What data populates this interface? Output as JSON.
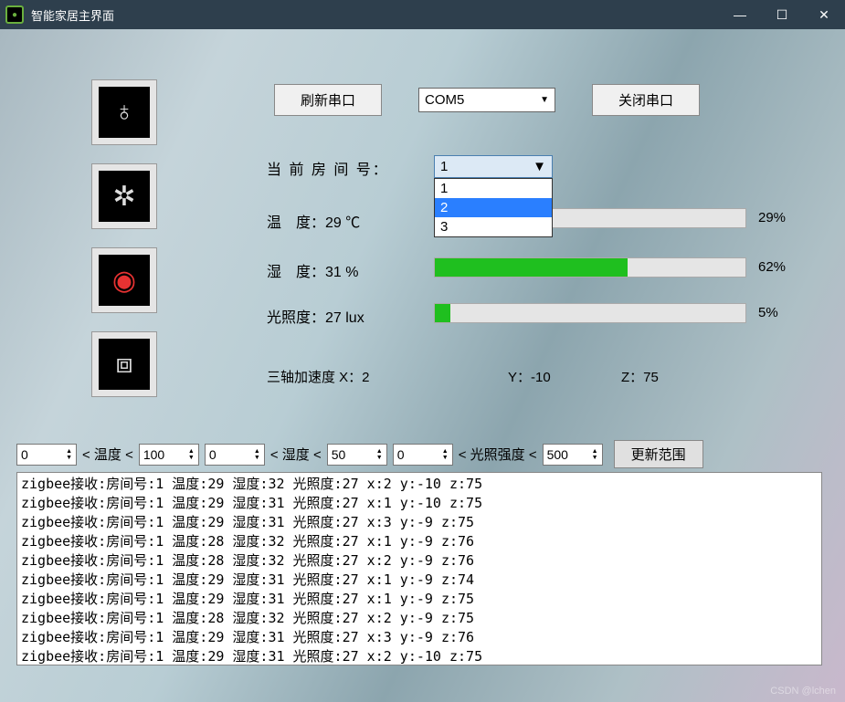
{
  "window": {
    "title": "智能家居主界面",
    "min": "—",
    "max": "☐",
    "close": "✕"
  },
  "icons": {
    "bulb": "bulb-icon",
    "fan": "fan-icon",
    "alarm": "alarm-icon",
    "segment": "seven-segment-icon"
  },
  "toolbar": {
    "refresh_label": "刷新串口",
    "com_value": "COM5",
    "close_label": "关闭串口"
  },
  "room": {
    "label": "当 前 房 间 号：",
    "selected": "1",
    "options": [
      "1",
      "2",
      "3"
    ],
    "highlighted_index": 1
  },
  "temp": {
    "label": "温　度：29 ℃",
    "pct_text": "29%",
    "pct": 29
  },
  "humi": {
    "label": "湿　度：31 %",
    "pct_text": "62%",
    "pct": 62
  },
  "lux": {
    "label": "光照度：27 lux",
    "pct_text": "5%",
    "pct": 5
  },
  "accel": {
    "x": "三轴加速度 X：2",
    "y": "Y：-10",
    "z": "Z：75"
  },
  "range": {
    "t_lo": "0",
    "t_lbl": "< 温度 <",
    "t_hi": "100",
    "h_lo": "0",
    "h_lbl": "< 湿度 <",
    "h_hi": "50",
    "l_lo": "0",
    "l_lbl": "< 光照强度 <",
    "l_hi": "500",
    "update": "更新范围"
  },
  "log_lines": [
    "zigbee接收:房间号:1 温度:29 湿度:32 光照度:27 x:2 y:-10 z:75",
    "zigbee接收:房间号:1 温度:29 湿度:31 光照度:27 x:1 y:-10 z:75",
    "zigbee接收:房间号:1 温度:29 湿度:31 光照度:27 x:3 y:-9 z:75",
    "zigbee接收:房间号:1 温度:28 湿度:32 光照度:27 x:1 y:-9 z:76",
    "zigbee接收:房间号:1 温度:28 湿度:32 光照度:27 x:2 y:-9 z:76",
    "zigbee接收:房间号:1 温度:29 湿度:31 光照度:27 x:1 y:-9 z:74",
    "zigbee接收:房间号:1 温度:29 湿度:31 光照度:27 x:1 y:-9 z:75",
    "zigbee接收:房间号:1 温度:28 湿度:32 光照度:27 x:2 y:-9 z:75",
    "zigbee接收:房间号:1 温度:29 湿度:31 光照度:27 x:3 y:-9 z:76",
    "zigbee接收:房间号:1 温度:29 湿度:31 光照度:27 x:2 y:-10 z:75"
  ],
  "watermark": "CSDN @lchen"
}
